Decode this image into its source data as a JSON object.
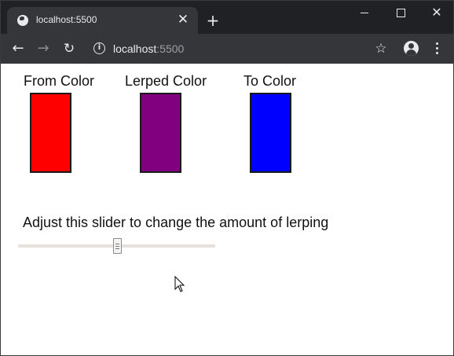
{
  "browser": {
    "tab_title": "localhost:5500",
    "url_host": "localhost",
    "url_port": ":5500",
    "tab_close_glyph": "✕",
    "new_tab_glyph": "+",
    "window_close_glyph": "✕",
    "back_glyph": "←",
    "forward_glyph": "→",
    "reload_glyph": "↻",
    "info_glyph": "i",
    "star_glyph": "☆",
    "icons": [
      "globe-icon",
      "close-icon",
      "plus-icon",
      "minimize-icon",
      "maximize-icon",
      "back-arrow-icon",
      "forward-arrow-icon",
      "reload-icon",
      "info-icon",
      "star-icon",
      "account-icon",
      "more-menu-icon"
    ]
  },
  "page": {
    "swatches": [
      {
        "label": "From Color",
        "color": "#ff0000"
      },
      {
        "label": "Lerped Color",
        "color": "#800080"
      },
      {
        "label": "To Color",
        "color": "#0000ff"
      }
    ],
    "slider_prompt": "Adjust this slider to change the amount of lerping",
    "slider_value": 0.5
  }
}
